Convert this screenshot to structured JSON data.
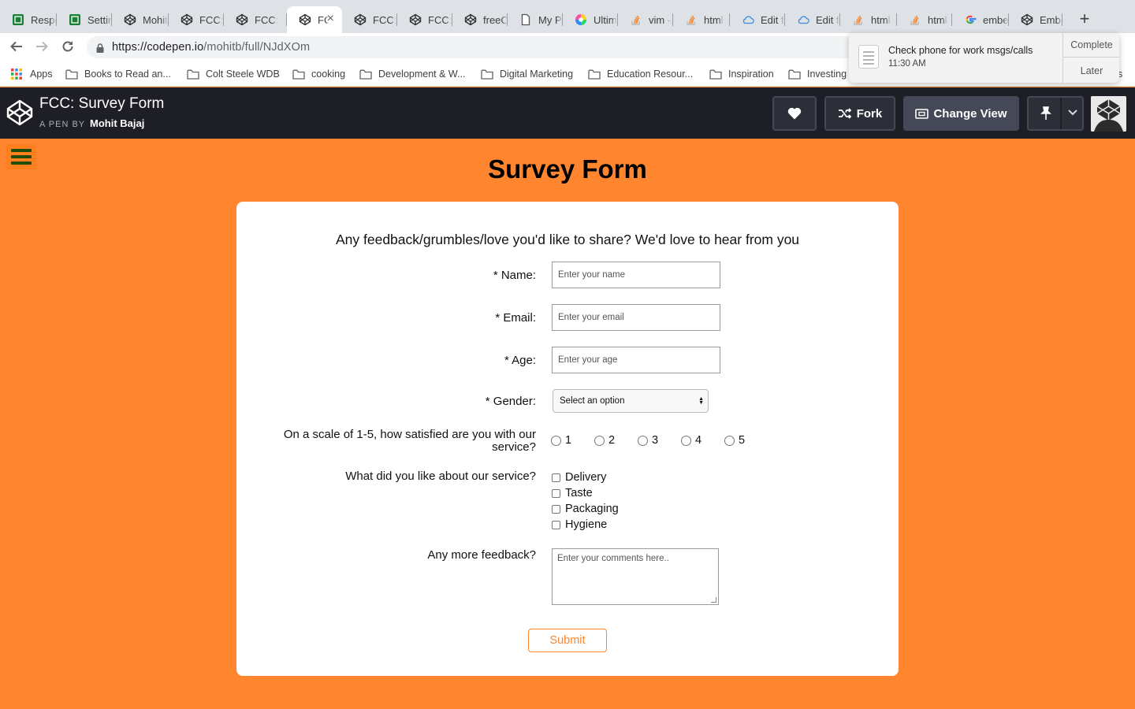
{
  "browser": {
    "tabs": [
      {
        "title": "Responsive",
        "favicon": "green-badge"
      },
      {
        "title": "Settings",
        "favicon": "green-badge"
      },
      {
        "title": "Mohit",
        "favicon": "codepen-logo"
      },
      {
        "title": "FCC:",
        "favicon": "codepen-logo"
      },
      {
        "title": "FCC:",
        "favicon": "codepen-logo"
      },
      {
        "title": "FC",
        "favicon": "codepen-logo"
      },
      {
        "title": "FCC:",
        "favicon": "codepen-logo"
      },
      {
        "title": "FCC:",
        "favicon": "codepen-logo"
      },
      {
        "title": "freeC",
        "favicon": "codepen-logo"
      },
      {
        "title": "My Pr",
        "favicon": "page"
      },
      {
        "title": "Ultim",
        "favicon": "color-wheel"
      },
      {
        "title": "vim -",
        "favicon": "stack-overflow"
      },
      {
        "title": "html",
        "favicon": "stack-overflow"
      },
      {
        "title": "Edit f",
        "favicon": "cloud"
      },
      {
        "title": "Edit f",
        "favicon": "cloud"
      },
      {
        "title": "html",
        "favicon": "stack-overflow"
      },
      {
        "title": "html",
        "favicon": "stack-overflow"
      },
      {
        "title": "embe",
        "favicon": "google-g"
      },
      {
        "title": "Embe",
        "favicon": "codepen-logo"
      }
    ],
    "active_tab_index": 5,
    "url_host": "https://codepen.io",
    "url_path": "/mohitb/full/NJdXOm",
    "bookmarks": [
      "Apps",
      "Books to Read an...",
      "Colt Steele WDB",
      "cooking",
      "Development & W...",
      "Digital Marketing",
      "Education Resour...",
      "Inspiration",
      "Investing"
    ],
    "bookmarks_overflow": "s"
  },
  "notification": {
    "title": "Check phone for work msgs/calls",
    "time": "11:30 AM",
    "complete_label": "Complete",
    "later_label": "Later"
  },
  "codepen": {
    "pen_title": "FCC: Survey Form",
    "byline_prefix": "A PEN BY",
    "author": "Mohit Bajaj",
    "fork_label": "Fork",
    "change_view_label": "Change View"
  },
  "page": {
    "title": "Survey Form",
    "description": "Any feedback/grumbles/love you'd like to share? We'd love to hear from you",
    "name_label": "* Name:",
    "name_placeholder": "Enter your name",
    "email_label": "* Email:",
    "email_placeholder": "Enter your email",
    "age_label": "* Age:",
    "age_placeholder": "Enter your age",
    "gender_label": "* Gender:",
    "gender_selected": "Select an option",
    "satisfaction_label_line1": "On a scale of 1-5, how satisfied are you with our",
    "satisfaction_label_line2": "service?",
    "ratings": [
      "1",
      "2",
      "3",
      "4",
      "5"
    ],
    "likes_label": "What did you like about our service?",
    "likes": [
      "Delivery",
      "Taste",
      "Packaging",
      "Hygiene"
    ],
    "feedback_label": "Any more feedback?",
    "feedback_placeholder": "Enter your comments here..",
    "submit_label": "Submit"
  },
  "colors": {
    "page_background": "#ff862f",
    "accent": "#ff862f",
    "codepen_header": "#1e1f26",
    "hamburger": "#1e4d0c"
  }
}
